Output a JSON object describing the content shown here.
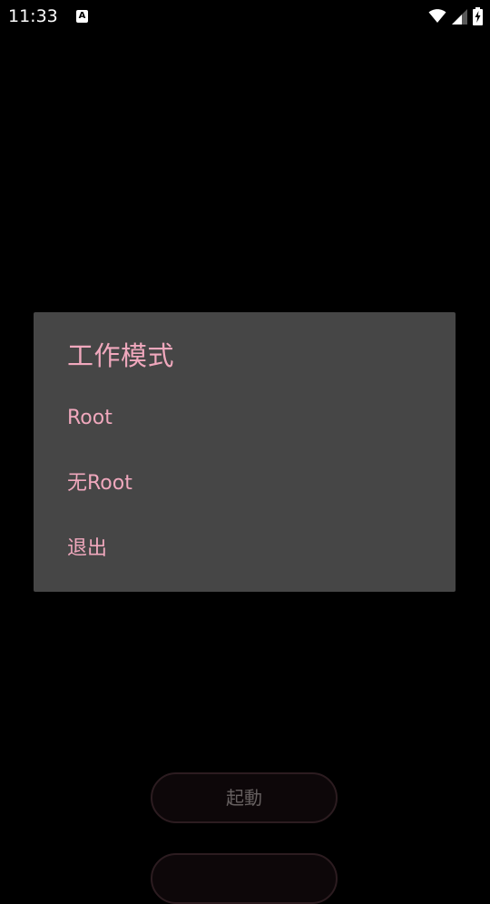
{
  "status_bar": {
    "time": "11:33",
    "notification_icon": "A",
    "icons": [
      "wifi-icon",
      "signal-icon",
      "battery-charging-icon"
    ]
  },
  "dialog": {
    "title": "工作模式",
    "items": [
      {
        "label": "Root"
      },
      {
        "label": "无Root"
      },
      {
        "label": "退出"
      }
    ]
  },
  "buttons": {
    "start_label": "起動"
  },
  "colors": {
    "background": "#000000",
    "dialog_background": "#464646",
    "accent_text": "#f0a8bd",
    "button_text": "#666060"
  }
}
